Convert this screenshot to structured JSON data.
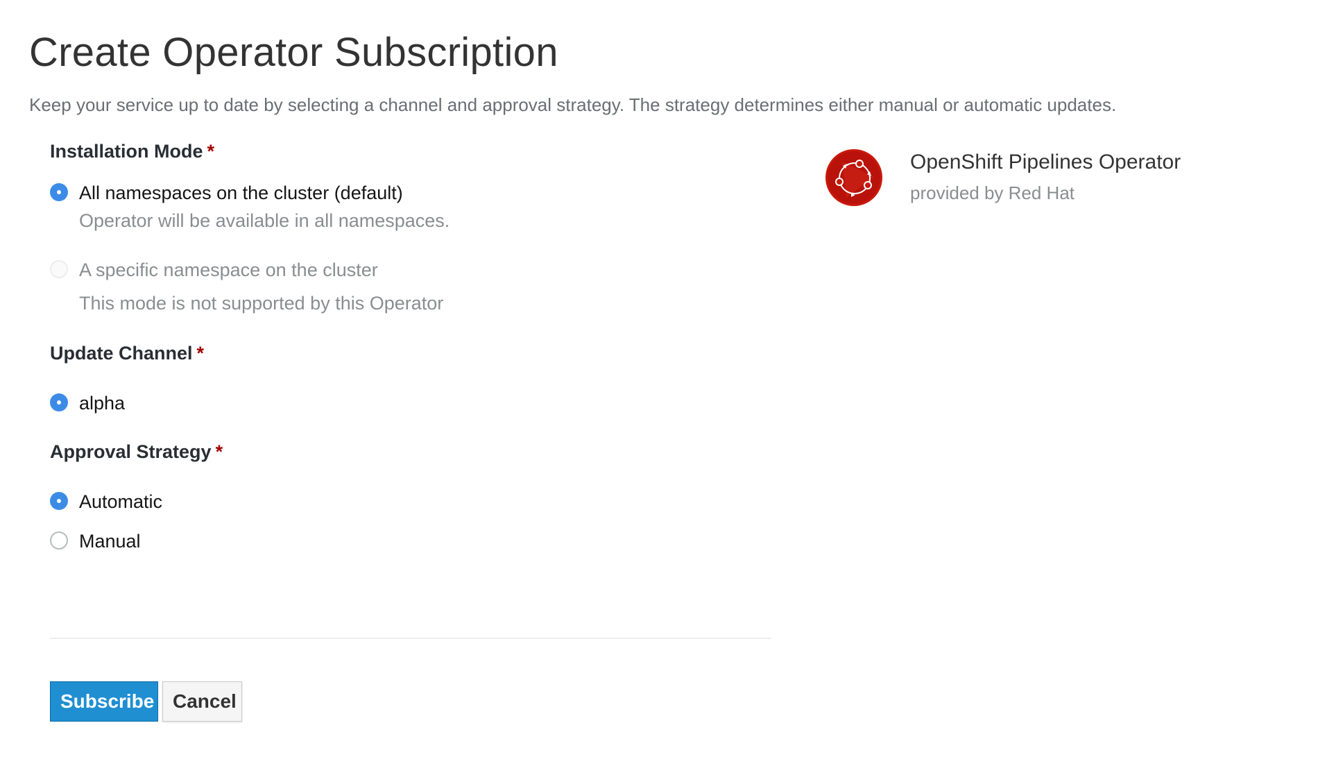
{
  "page": {
    "title": "Create Operator Subscription",
    "description": "Keep your service up to date by selecting a channel and approval strategy. The strategy determines either manual or automatic updates."
  },
  "installation_mode": {
    "label": "Installation Mode",
    "required_mark": "*",
    "options": [
      {
        "label": "All namespaces on the cluster (default)",
        "help": "Operator will be available in all namespaces.",
        "selected": true,
        "disabled": false
      },
      {
        "label": "A specific namespace on the cluster",
        "help": "This mode is not supported by this Operator",
        "selected": false,
        "disabled": true
      }
    ]
  },
  "update_channel": {
    "label": "Update Channel",
    "required_mark": "*",
    "options": [
      {
        "label": "alpha",
        "selected": true
      }
    ]
  },
  "approval_strategy": {
    "label": "Approval Strategy",
    "required_mark": "*",
    "options": [
      {
        "label": "Automatic",
        "selected": true
      },
      {
        "label": "Manual",
        "selected": false
      }
    ]
  },
  "actions": {
    "subscribe_label": "Subscribe",
    "cancel_label": "Cancel"
  },
  "operator": {
    "name": "OpenShift Pipelines Operator",
    "provider": "provided by Red Hat",
    "logo_icon": "openshift-pipelines-logo-icon"
  },
  "colors": {
    "radio_selected": "#3c8ce7",
    "required_mark": "#a30000",
    "primary_button": "#1f8fd1",
    "logo_red": "#c9190b"
  }
}
